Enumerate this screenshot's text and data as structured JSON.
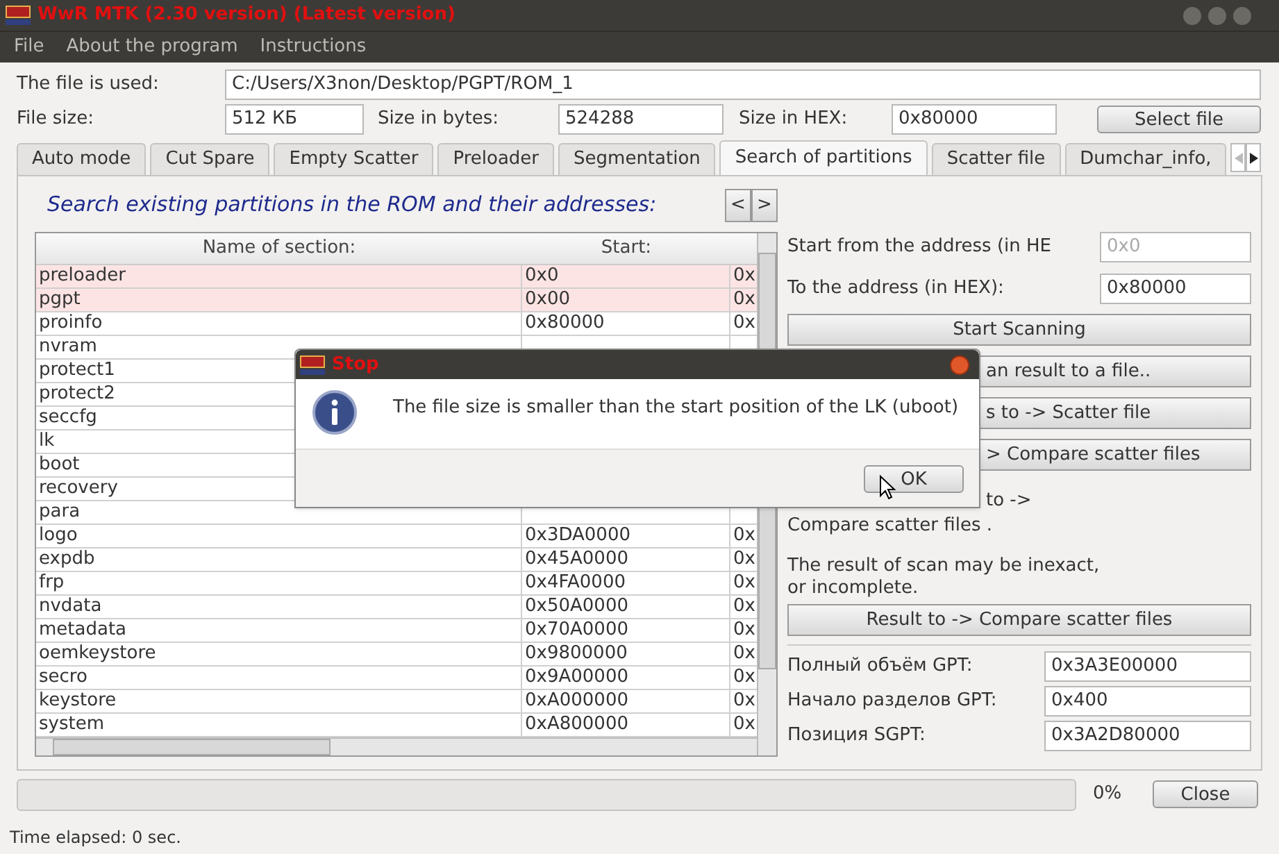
{
  "window": {
    "title": "WwR MTK (2.30 version) (Latest version)"
  },
  "menu": [
    {
      "label": "File"
    },
    {
      "label": "About the program"
    },
    {
      "label": "Instructions"
    }
  ],
  "file_row": {
    "label": "The file is used:",
    "value": "C:/Users/X3non/Desktop/PGPT/ROM_1"
  },
  "size_fields": [
    {
      "label": "File size:",
      "value": "512 КБ"
    },
    {
      "label": "Size in bytes:",
      "value": "524288"
    },
    {
      "label": "Size in HEX:",
      "value": "0x80000"
    }
  ],
  "select_button": "Select file",
  "tabs": [
    {
      "label": "Auto mode",
      "selected": false
    },
    {
      "label": "Cut Spare",
      "selected": false
    },
    {
      "label": "Empty Scatter",
      "selected": false
    },
    {
      "label": "Preloader",
      "selected": false
    },
    {
      "label": "Segmentation",
      "selected": false
    },
    {
      "label": "Search of partitions",
      "selected": true
    },
    {
      "label": "Scatter file",
      "selected": false
    },
    {
      "label": "Dumchar_info,",
      "selected": false
    }
  ],
  "heading": "Search existing partitions in the ROM and their addresses:",
  "pager": [
    "<",
    ">"
  ],
  "table": {
    "columns": [
      "Name of section:",
      "Start:"
    ],
    "rows": [
      {
        "name": "preloader",
        "start": "0x0",
        "column_3": "0x",
        "highlighted": true
      },
      {
        "name": "pgpt",
        "start": "0x00",
        "column_3": "0x",
        "highlighted": true
      },
      {
        "name": "proinfo",
        "start": "0x80000",
        "column_3": "0x",
        "highlighted": false
      },
      {
        "name": "nvram",
        "highlighted": false
      },
      {
        "name": "protect1",
        "highlighted": false
      },
      {
        "name": "protect2",
        "highlighted": false
      },
      {
        "name": "seccfg",
        "highlighted": false
      },
      {
        "name": "lk",
        "highlighted": false
      },
      {
        "name": "boot",
        "highlighted": false
      },
      {
        "name": "recovery",
        "highlighted": false
      },
      {
        "name": "para",
        "highlighted": false
      },
      {
        "name": "logo",
        "start": "0x3DA0000",
        "column_3": "0x",
        "highlighted": false
      },
      {
        "name": "expdb",
        "start": "0x45A0000",
        "column_3": "0x",
        "highlighted": false
      },
      {
        "name": "frp",
        "start": "0x4FA0000",
        "column_3": "0x",
        "highlighted": false
      },
      {
        "name": "nvdata",
        "start": "0x50A0000",
        "column_3": "0x",
        "highlighted": false
      },
      {
        "name": "metadata",
        "start": "0x70A0000",
        "column_3": "0x",
        "highlighted": false
      },
      {
        "name": "oemkeystore",
        "start": "0x9800000",
        "column_3": "0x",
        "highlighted": false
      },
      {
        "name": "secro",
        "start": "0x9A00000",
        "column_3": "0x",
        "highlighted": false
      },
      {
        "name": "keystore",
        "start": "0xA000000",
        "column_3": "0x",
        "highlighted": false
      },
      {
        "name": "system",
        "start": "0xA800000",
        "column_3": "0x",
        "highlighted": false
      }
    ]
  },
  "address_fields": [
    {
      "label": "Start from the address (in HE",
      "value": "0x0",
      "disabled": true
    },
    {
      "label": "To the address (in HEX):",
      "value": "0x80000",
      "disabled": false
    }
  ],
  "start_button": "Start Scanning",
  "partial_buttons": [
    "an result to a file..",
    "s to -> Scatter file",
    "> Compare scatter files"
  ],
  "note_partial": "to ->",
  "note": "Compare scatter files .",
  "warning": [
    "The result of scan may be inexact,",
    "or incomplete."
  ],
  "result_button": "Result to -> Compare scatter files",
  "gpt_fields": [
    {
      "label": "Полный объём GPT:",
      "value": "0x3A3E00000"
    },
    {
      "label": "Начало разделов GPT:",
      "value": "0x400"
    },
    {
      "label": "Позиция SGPT:",
      "value": "0x3A2D80000"
    }
  ],
  "progress": {
    "level": 0,
    "reading": "0%"
  },
  "close_button": "Close",
  "status": "Time elapsed: 0  sec.",
  "dialog": {
    "title": "Stop",
    "message": "The file size is smaller than the start position of the LK (uboot)",
    "ok": "OK"
  }
}
